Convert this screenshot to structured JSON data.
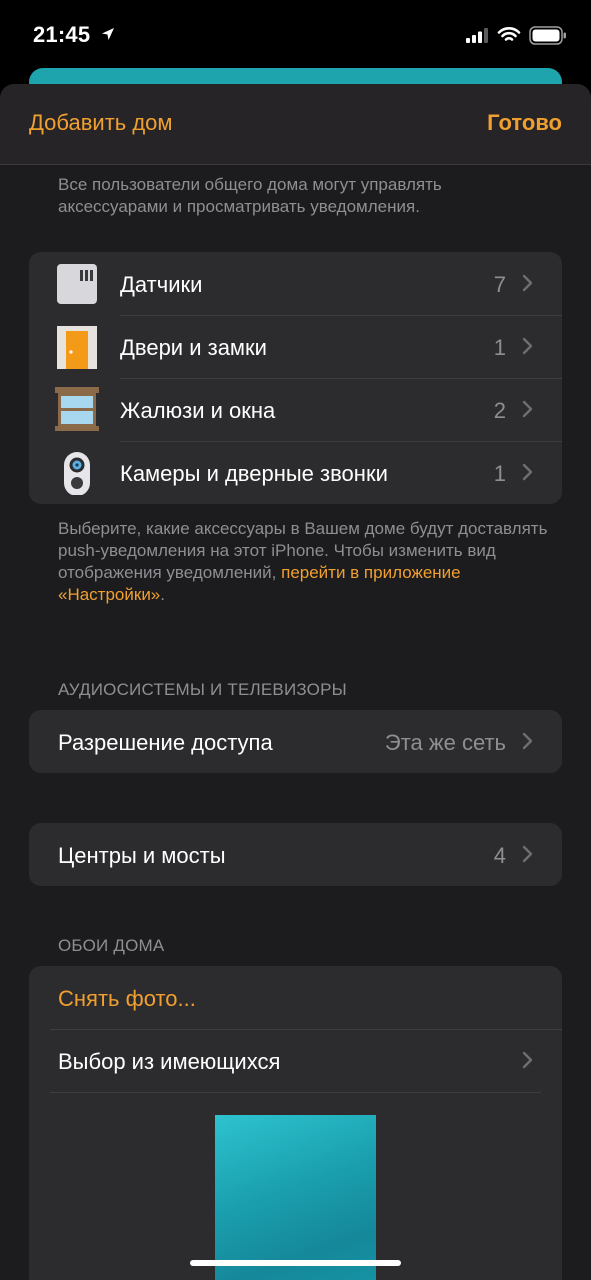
{
  "status_bar": {
    "time": "21:45"
  },
  "navbar": {
    "add_home": "Добавить дом",
    "done": "Готово"
  },
  "top_footnote": "Все пользователи общего дома могут управлять аксессуарами и просматривать уведомления.",
  "accessories": [
    {
      "label": "Датчики",
      "count": "7",
      "icon": "sensor-icon"
    },
    {
      "label": "Двери и замки",
      "count": "1",
      "icon": "door-icon"
    },
    {
      "label": "Жалюзи и окна",
      "count": "2",
      "icon": "window-icon"
    },
    {
      "label": "Камеры и дверные звонки",
      "count": "1",
      "icon": "doorbell-camera-icon"
    }
  ],
  "notifications_footnote": {
    "text": "Выберите, какие аксессуары в Вашем доме будут доставлять push-уведомления на этот iPhone. Чтобы изменить вид отображения уведомлений, ",
    "link": "перейти в приложение «Настройки»",
    "end": "."
  },
  "audio_section": {
    "header": "АУДИОСИСТЕМЫ И ТЕЛЕВИЗОРЫ",
    "row_label": "Разрешение доступа",
    "row_value": "Эта же сеть"
  },
  "hubs": {
    "label": "Центры и мосты",
    "count": "4"
  },
  "wallpaper_section": {
    "header": "ОБОИ ДОМА",
    "take_photo": "Снять фото...",
    "choose_existing": "Выбор из имеющихся"
  },
  "colors": {
    "accent": "#f0a030",
    "background": "#1c1c1e",
    "cell": "#2c2c2e",
    "secondary_text": "#8e8e93",
    "wallpaper": "#1ea4ad"
  }
}
